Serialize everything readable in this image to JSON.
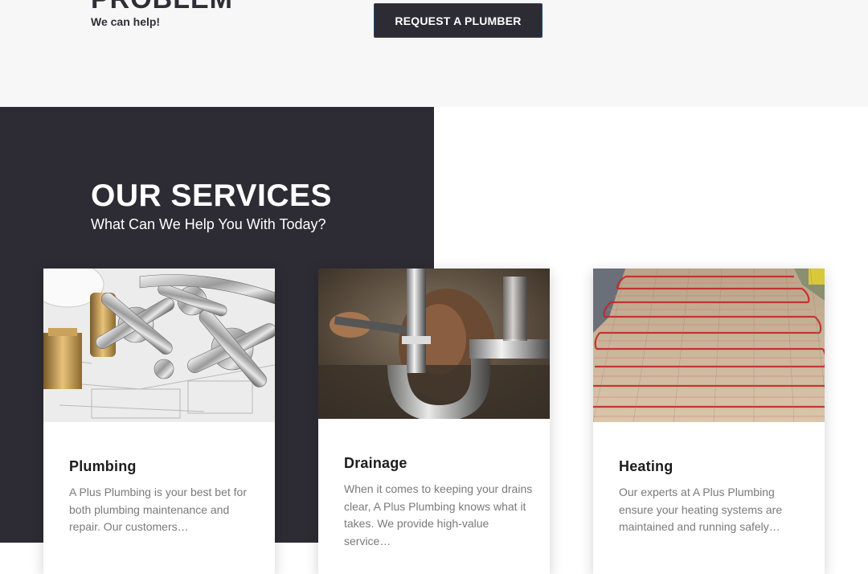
{
  "hero": {
    "heading": "PROBLEM",
    "subtext": "We can help!",
    "cta_label": "REQUEST A PLUMBER"
  },
  "services": {
    "title": "OUR SERVICES",
    "subtitle": "What Can We Help You With Today?",
    "cards": [
      {
        "title": "Plumbing",
        "text": "A Plus Plumbing is your best bet for both plumbing maintenance and repair. Our customers…",
        "image": "plumbing-fixtures-photo"
      },
      {
        "title": "Drainage",
        "text": "When it comes to keeping your drains clear, A Plus Plumbing knows what it takes. We provide high-value service…",
        "image": "plumber-at-work-photo"
      },
      {
        "title": "Heating",
        "text": "Our experts at A Plus Plumbing ensure your heating systems are maintained and running safely…",
        "image": "underfloor-heating-photo"
      }
    ]
  },
  "colors": {
    "dark": "#2d2c34",
    "light_band": "#f7f7f7",
    "button_border": "#1f4a6a",
    "body_text": "#7a7a7a"
  }
}
